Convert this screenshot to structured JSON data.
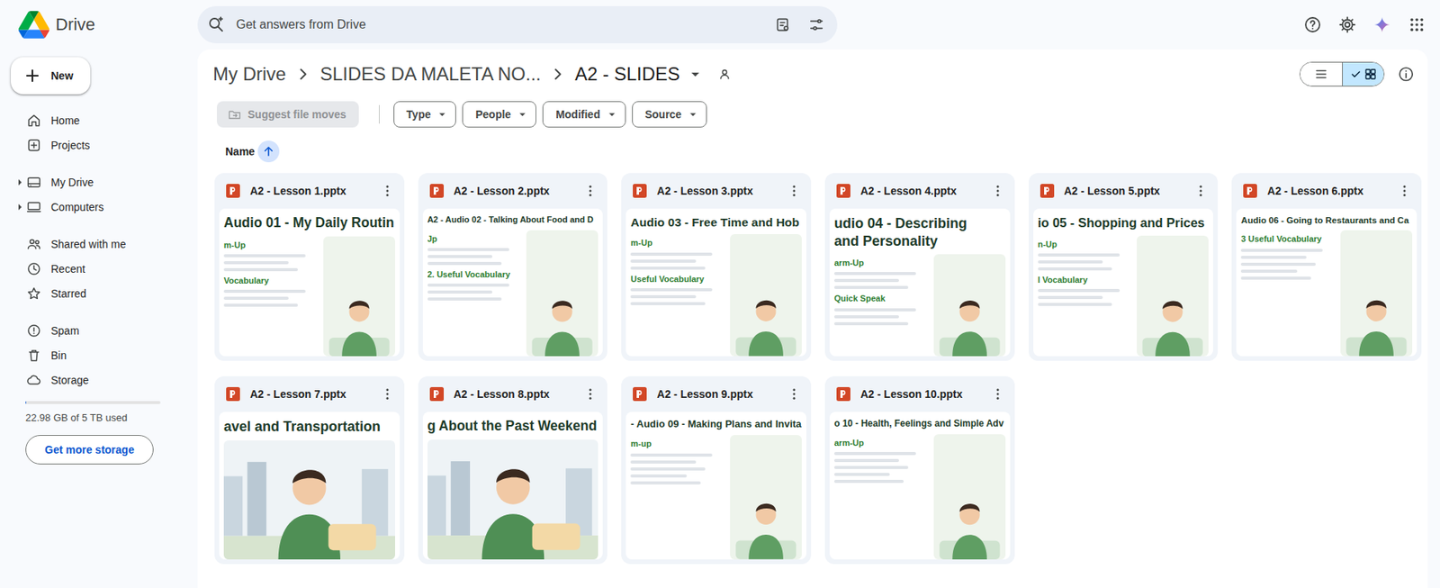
{
  "app": {
    "title": "Drive"
  },
  "search": {
    "placeholder": "Get answers from Drive"
  },
  "new_button": {
    "label": "New"
  },
  "sidebar": {
    "groups": [
      [
        {
          "label": "Home",
          "expandable": false
        },
        {
          "label": "Projects",
          "expandable": false
        }
      ],
      [
        {
          "label": "My Drive",
          "expandable": true
        },
        {
          "label": "Computers",
          "expandable": true
        }
      ],
      [
        {
          "label": "Shared with me",
          "expandable": false
        },
        {
          "label": "Recent",
          "expandable": false
        },
        {
          "label": "Starred",
          "expandable": false
        }
      ],
      [
        {
          "label": "Spam",
          "expandable": false
        },
        {
          "label": "Bin",
          "expandable": false
        },
        {
          "label": "Storage",
          "expandable": false
        }
      ]
    ]
  },
  "storage": {
    "text": "22.98 GB of 5 TB used",
    "level": 0.0045,
    "button": "Get more storage"
  },
  "breadcrumb": [
    {
      "label": "My Drive",
      "current": false
    },
    {
      "label": "SLIDES DA MALETA NO...",
      "current": false
    },
    {
      "label": "A2 - SLIDES",
      "current": true
    }
  ],
  "view_toggle": [
    {
      "selected": false
    },
    {
      "selected": true
    }
  ],
  "filters": {
    "suggest": {
      "label": "Suggest file moves",
      "disabled": true
    },
    "chips": [
      "Type",
      "People",
      "Modified",
      "Source"
    ]
  },
  "sort": {
    "label": "Name",
    "ascending": true
  },
  "files": [
    {
      "name": "A2 - Lesson 1.pptx",
      "thumbnail": {
        "kind": "split",
        "title": [
          "Audio 01 - My Daily Routin"
        ],
        "labels": [
          "m-Up",
          "Vocabulary"
        ]
      }
    },
    {
      "name": "A2 - Lesson 2.pptx",
      "thumbnail": {
        "kind": "split",
        "title": [
          "A2 - Audio 02 - Talking About Food and D"
        ],
        "labels": [
          "Jp",
          "2. Useful Vocabulary"
        ]
      }
    },
    {
      "name": "A2 - Lesson 3.pptx",
      "thumbnail": {
        "kind": "split",
        "title": [
          "Audio 03 - Free Time and Hob"
        ],
        "labels": [
          "m-Up",
          "Useful Vocabulary"
        ]
      }
    },
    {
      "name": "A2 - Lesson 4.pptx",
      "thumbnail": {
        "kind": "split",
        "title": [
          "udio 04 - Describing",
          "and Personality"
        ],
        "labels": [
          "arm-Up",
          "Quick Speak"
        ]
      }
    },
    {
      "name": "A2 - Lesson 5.pptx",
      "thumbnail": {
        "kind": "split",
        "title": [
          "io 05 - Shopping and Prices"
        ],
        "labels": [
          "n-Up",
          "l Vocabulary"
        ]
      }
    },
    {
      "name": "A2 - Lesson 6.pptx",
      "thumbnail": {
        "kind": "split",
        "title": [
          "Audio 06 - Going to Restaurants and Ca"
        ],
        "labels": [
          "3 Useful Vocabulary"
        ]
      }
    },
    {
      "name": "A2 - Lesson 7.pptx",
      "thumbnail": {
        "kind": "scene",
        "title": [
          "avel and Transportation"
        ],
        "labels": []
      }
    },
    {
      "name": "A2 - Lesson 8.pptx",
      "thumbnail": {
        "kind": "scene",
        "title": [
          "g About the Past Weekend"
        ],
        "labels": []
      }
    },
    {
      "name": "A2 - Lesson 9.pptx",
      "thumbnail": {
        "kind": "split",
        "title": [
          "- Audio 09 - Making Plans and Invita"
        ],
        "labels": [
          "m-up"
        ]
      }
    },
    {
      "name": "A2 - Lesson 10.pptx",
      "thumbnail": {
        "kind": "split",
        "title": [
          "o 10 - Health, Feelings and Simple Adv"
        ],
        "labels": [
          "arm-Up"
        ]
      }
    }
  ]
}
